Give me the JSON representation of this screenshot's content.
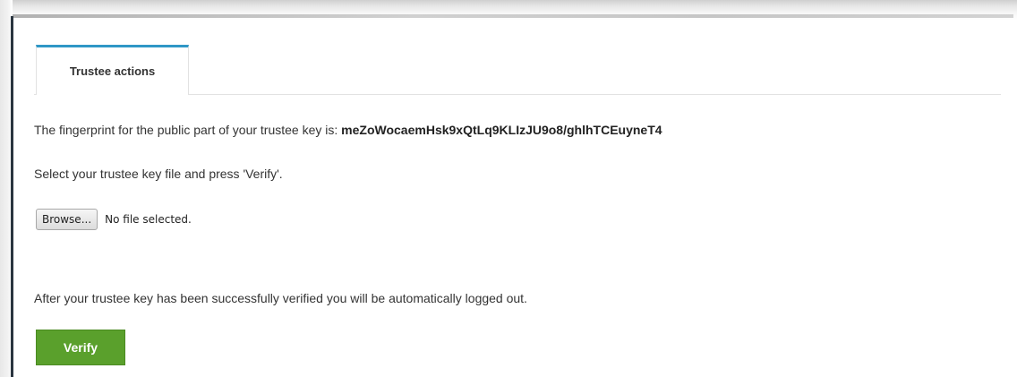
{
  "tabs": {
    "active_label": "Trustee actions"
  },
  "fingerprint": {
    "prefix": "The fingerprint for the public part of your trustee key is: ",
    "value": "meZoWocaemHsk9xQtLq9KLIzJU9o8/ghlhTCEuyneT4"
  },
  "instructions": {
    "select": "Select your trustee key file and press 'Verify'.",
    "after": "After your trustee key has been successfully verified you will be automatically logged out."
  },
  "file_input": {
    "button_label": "Browse...",
    "status": "No file selected."
  },
  "actions": {
    "verify_label": "Verify"
  },
  "colors": {
    "tab_accent": "#2f97c6",
    "verify_bg": "#5aa02c",
    "left_bar": "#2a3540"
  }
}
